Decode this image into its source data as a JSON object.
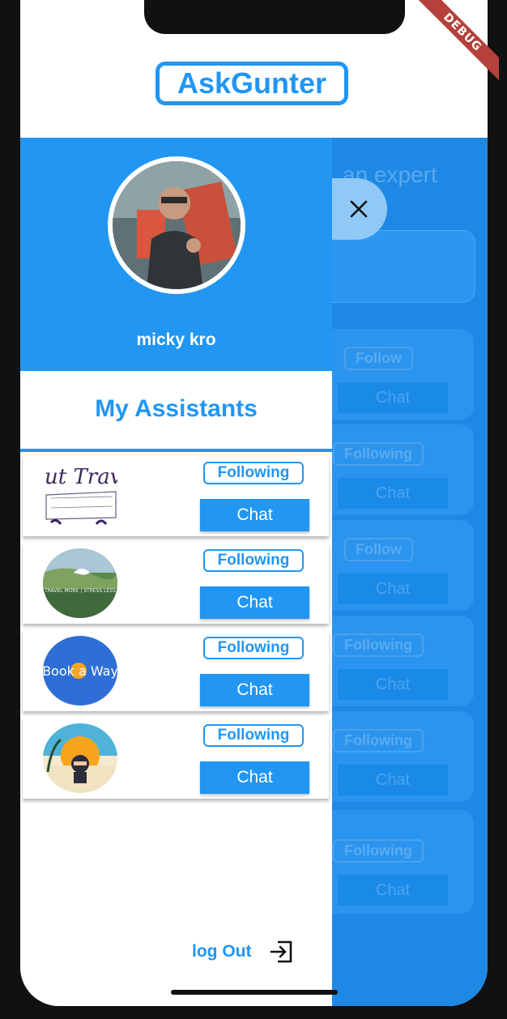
{
  "app": {
    "logo_text": "AskGunter",
    "debug_label": "DEBUG"
  },
  "background": {
    "partial_title": "an expert",
    "cards": [
      {
        "follow_label": "Follow",
        "chat_label": "Chat"
      },
      {
        "follow_label": "Following",
        "chat_label": "Chat"
      },
      {
        "follow_label": "Follow",
        "chat_label": "Chat"
      },
      {
        "follow_label": "Following",
        "chat_label": "Chat"
      },
      {
        "follow_label": "Following",
        "chat_label": "Chat"
      },
      {
        "follow_label": "Following",
        "chat_label": "Chat"
      }
    ]
  },
  "drawer": {
    "user_name": "micky kro",
    "section_title": "My Assistants",
    "assistants": [
      {
        "logo_text": "ut Trav",
        "following_label": "Following",
        "chat_label": "Chat"
      },
      {
        "logo_text": "TRAVEL MORE | STRESS LESS",
        "following_label": "Following",
        "chat_label": "Chat"
      },
      {
        "logo_text": "Book a Way",
        "following_label": "Following",
        "chat_label": "Chat"
      },
      {
        "logo_text": "",
        "following_label": "Following",
        "chat_label": "Chat"
      }
    ],
    "logout_label": "log Out"
  },
  "colors": {
    "primary": "#2196f3",
    "backdrop": "#1e88e5",
    "debug": "#b4413b"
  },
  "icons": {
    "close": "close-icon",
    "logout": "logout-icon"
  }
}
